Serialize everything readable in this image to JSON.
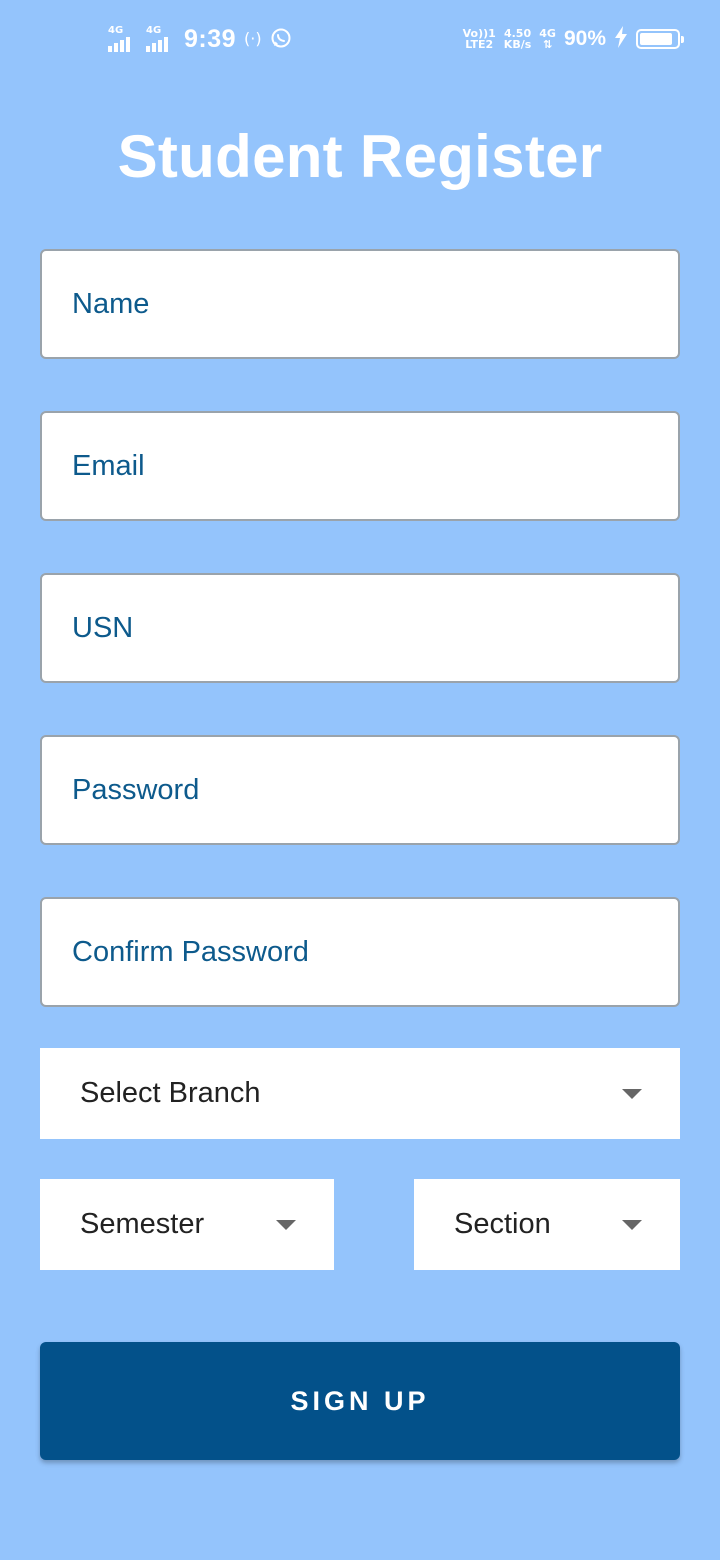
{
  "status_bar": {
    "sim1_network": "4G",
    "sim2_network": "4G",
    "time": "9:39",
    "hotspot_icon": "hotspot-icon",
    "whatsapp_icon": "whatsapp-icon",
    "volte_top": "Vo))1",
    "volte_bottom": "LTE2",
    "speed_value": "4.50",
    "speed_unit": "KB/s",
    "data_network": "4G",
    "battery_percent": "90%",
    "charging_icon": "lightning-icon",
    "battery_icon": "battery-icon"
  },
  "page": {
    "title": "Student Register"
  },
  "form": {
    "name_placeholder": "Name",
    "email_placeholder": "Email",
    "usn_placeholder": "USN",
    "password_placeholder": "Password",
    "confirm_password_placeholder": "Confirm Password",
    "branch_label": "Select Branch",
    "semester_label": "Semester",
    "section_label": "Section",
    "signup_label": "SIGN UP"
  },
  "colors": {
    "background": "#94c4fc",
    "button": "#03518a",
    "input_text": "#0d5a8c"
  }
}
